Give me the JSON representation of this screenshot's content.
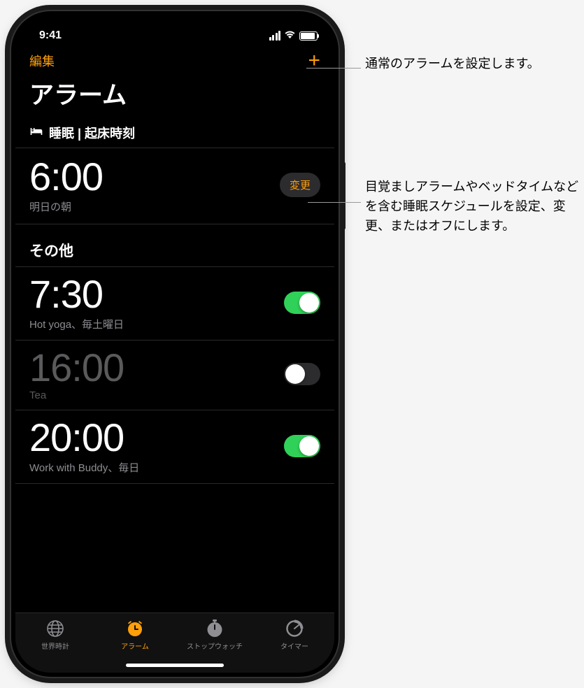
{
  "status": {
    "time": "9:41"
  },
  "nav": {
    "edit": "編集",
    "title": "アラーム"
  },
  "sleep_section": {
    "header": "睡眠 | 起床時刻",
    "time": "6:00",
    "subtitle": "明日の朝",
    "change": "変更"
  },
  "other_section_label": "その他",
  "alarms": [
    {
      "time": "7:30",
      "label": "Hot yoga、毎土曜日",
      "on": true
    },
    {
      "time": "16:00",
      "label": "Tea",
      "on": false
    },
    {
      "time": "20:00",
      "label": "Work with Buddy、毎日",
      "on": true
    }
  ],
  "tabs": {
    "world": "世界時計",
    "alarm": "アラーム",
    "stopwatch": "ストップウォッチ",
    "timer": "タイマー"
  },
  "callouts": {
    "add": "通常のアラームを設定します。",
    "change": "目覚ましアラームやベッドタイムなどを含む睡眠スケジュールを設定、変更、またはオフにします。"
  }
}
